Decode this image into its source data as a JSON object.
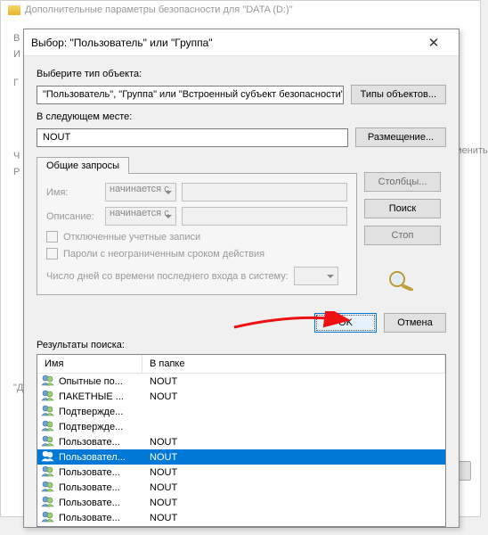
{
  "background": {
    "title": "Дополнительные параметры безопасности для \"DATA (D:)\"",
    "edit_hint": "менить"
  },
  "dialog": {
    "title": "Выбор: \"Пользователь\" или \"Группа\"",
    "object_type_label": "Выберите тип объекта:",
    "object_type_value": "\"Пользователь\", \"Группа\" или \"Встроенный субъект безопасности\"",
    "object_types_btn": "Типы объектов...",
    "location_label": "В следующем месте:",
    "location_value": "NOUT",
    "location_btn": "Размещение...",
    "tab_label": "Общие запросы",
    "name_label": "Имя:",
    "desc_label": "Описание:",
    "starts_with": "начинается с",
    "disabled_accounts": "Отключенные учетные записи",
    "non_expiring": "Пароли с неограниченным сроком действия",
    "days_label": "Число дней со времени последнего входа в систему:",
    "columns_btn": "Столбцы...",
    "find_btn": "Поиск",
    "stop_btn": "Стоп",
    "ok_btn": "OK",
    "cancel_btn": "Отмена",
    "results_label": "Результаты поиска:",
    "header_name": "Имя",
    "header_folder": "В папке",
    "rows": [
      {
        "name": "Опытные по...",
        "folder": "NOUT"
      },
      {
        "name": "ПАКЕТНЫЕ ...",
        "folder": "NOUT"
      },
      {
        "name": "Подтвержде...",
        "folder": ""
      },
      {
        "name": "Подтвержде...",
        "folder": ""
      },
      {
        "name": "Пользовате...",
        "folder": "NOUT"
      },
      {
        "name": "Пользовател...",
        "folder": "NOUT",
        "selected": true
      },
      {
        "name": "Пользовате...",
        "folder": "NOUT"
      },
      {
        "name": "Пользовате...",
        "folder": "NOUT"
      },
      {
        "name": "Пользовате...",
        "folder": "NOUT"
      },
      {
        "name": "Пользовате...",
        "folder": "NOUT"
      }
    ]
  }
}
